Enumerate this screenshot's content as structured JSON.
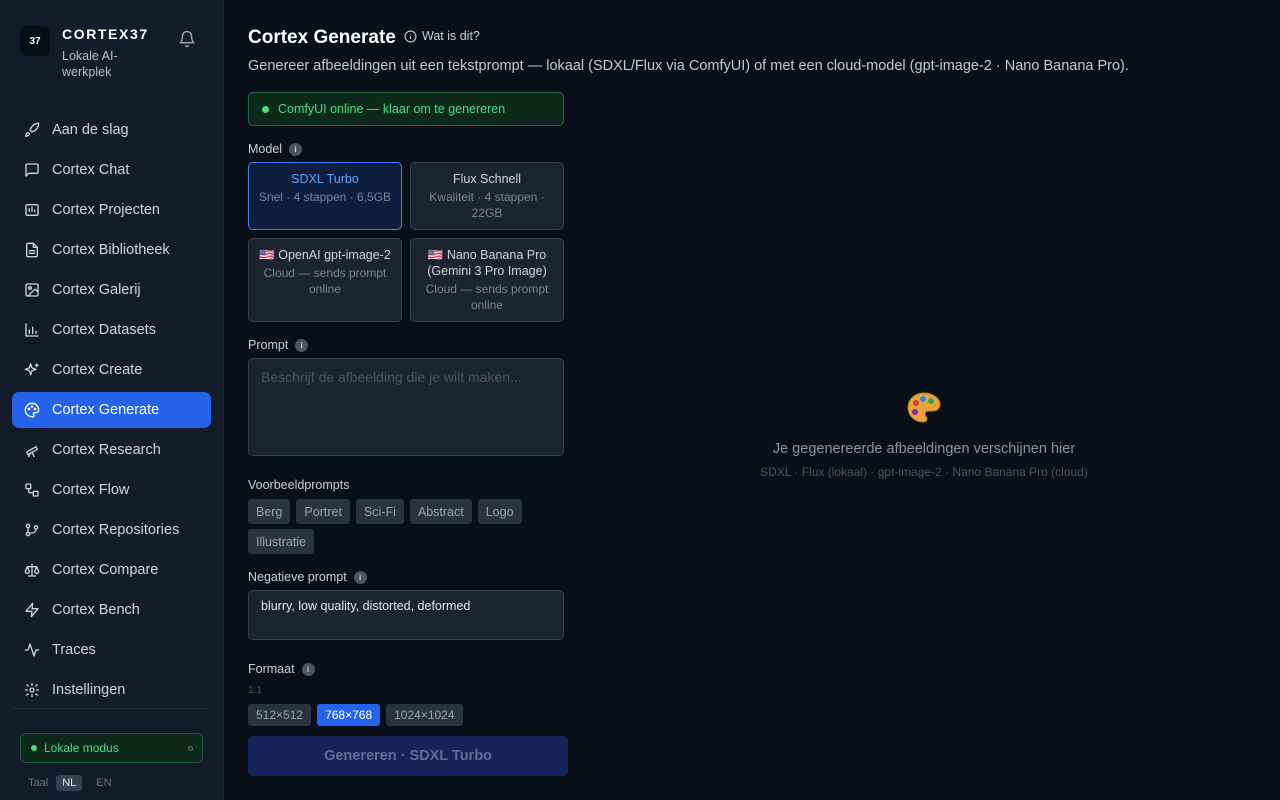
{
  "brand": {
    "logo_text": "37",
    "name": "CORTEX37",
    "subtitle": "Lokale AI-werkplek"
  },
  "sidebar": {
    "items": [
      {
        "label": "Aan de slag",
        "icon": "rocket-icon"
      },
      {
        "label": "Cortex Chat",
        "icon": "chat-icon"
      },
      {
        "label": "Cortex Projecten",
        "icon": "folder-icon"
      },
      {
        "label": "Cortex Bibliotheek",
        "icon": "document-icon"
      },
      {
        "label": "Cortex Galerij",
        "icon": "image-icon"
      },
      {
        "label": "Cortex Datasets",
        "icon": "bar-chart-icon"
      },
      {
        "label": "Cortex Create",
        "icon": "sparkles-icon"
      },
      {
        "label": "Cortex Generate",
        "icon": "palette-icon",
        "active": true
      },
      {
        "label": "Cortex Research",
        "icon": "telescope-icon"
      },
      {
        "label": "Cortex Flow",
        "icon": "workflow-icon"
      },
      {
        "label": "Cortex Repositories",
        "icon": "git-branch-icon"
      },
      {
        "label": "Cortex Compare",
        "icon": "scale-icon"
      },
      {
        "label": "Cortex Bench",
        "icon": "lightning-icon"
      },
      {
        "label": "Traces",
        "icon": "activity-icon"
      },
      {
        "label": "Instellingen",
        "icon": "gear-icon"
      }
    ],
    "mode_label": "Lokale modus",
    "lang_label": "Taal",
    "lang_options": [
      "NL",
      "EN"
    ],
    "lang_selected": "NL"
  },
  "header": {
    "title": "Cortex Generate",
    "help_link": "Wat is dit?",
    "subtitle": "Genereer afbeeldingen uit een tekstprompt — lokaal (SDXL/Flux via ComfyUI) of met een cloud-model (gpt-image-2 · Nano Banana Pro)."
  },
  "status": {
    "text": "ComfyUI online — klaar om te genereren",
    "color": "#4ade80"
  },
  "model": {
    "label": "Model",
    "options": [
      {
        "name": "SDXL Turbo",
        "desc": "Snel · 4 stappen · 6,5GB",
        "selected": true
      },
      {
        "name": "Flux Schnell",
        "desc": "Kwaliteit · 4 stappen · 22GB"
      },
      {
        "name": "🇺🇸 OpenAI gpt-image-2",
        "desc": "Cloud — sends prompt online"
      },
      {
        "name": "🇺🇸 Nano Banana Pro (Gemini 3 Pro Image)",
        "desc": "Cloud — sends prompt online"
      }
    ]
  },
  "prompt": {
    "label": "Prompt",
    "placeholder": "Beschrijf de afbeelding die je wilt maken...",
    "value": ""
  },
  "examples": {
    "label": "Voorbeeldprompts",
    "items": [
      "Berg",
      "Portret",
      "Sci-Fi",
      "Abstract",
      "Logo",
      "Illustratie"
    ]
  },
  "negative": {
    "label": "Negatieve prompt",
    "value": "blurry, low quality, distorted, deformed"
  },
  "format": {
    "label": "Formaat",
    "ratio": "1:1",
    "options": [
      "512×512",
      "768×768",
      "1024×1024"
    ],
    "selected": "768×768"
  },
  "generate_button": "Genereren · SDXL Turbo",
  "empty_state": {
    "title": "Je gegenereerde afbeeldingen verschijnen hier",
    "subtitle": "SDXL · Flux (lokaal) · gpt-image-2 · Nano Banana Pro (cloud)"
  },
  "colors": {
    "accent": "#2563eb",
    "status_green": "#4ade80",
    "background": "#0b0f1a",
    "sidebar": "#141b2b"
  }
}
